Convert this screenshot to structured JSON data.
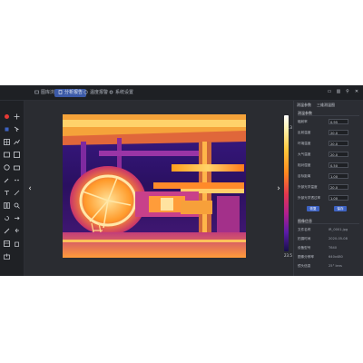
{
  "tabs": [
    {
      "label": "图库浏览",
      "active": false
    },
    {
      "label": "分析报告",
      "active": true
    },
    {
      "label": "温度报警",
      "active": false
    },
    {
      "label": "系统设置",
      "active": false
    }
  ],
  "window_controls": [
    "minimize",
    "settings",
    "restore",
    "close"
  ],
  "left_tools": [
    "record-icon",
    "crosshair-icon",
    "grid-icon",
    "chart-icon",
    "image-icon",
    "line-icon",
    "palette-icon",
    "camera-icon",
    "text-icon",
    "pen-icon",
    "compare-icon",
    "zoom-icon",
    "rotate-icon",
    "brush-icon",
    "table-icon",
    "export-icon"
  ],
  "scale": {
    "top": "82.3",
    "bottom": "23.5"
  },
  "colors": {
    "accent": "#3c5aa8",
    "button": "#3d62c2"
  },
  "panel": {
    "tabs": [
      "测温参数",
      "三维测温图"
    ],
    "section1_title": "测温参数",
    "rows": [
      {
        "label": "辐射率",
        "value": "0.95",
        "type": "field"
      },
      {
        "label": "反射温度",
        "value": "20.0",
        "type": "field"
      },
      {
        "label": "环境温度",
        "value": "20.0",
        "type": "field"
      },
      {
        "label": "大气温度",
        "value": "20.0",
        "type": "field"
      },
      {
        "label": "相对湿度",
        "value": "0.50",
        "type": "field"
      },
      {
        "label": "目标距离",
        "value": "1.00",
        "type": "field"
      },
      {
        "label": "外部光学温度",
        "value": "20.0",
        "type": "field"
      },
      {
        "label": "外部光学透过率",
        "value": "1.00",
        "type": "field"
      }
    ],
    "buttons": [
      "恢复",
      "保存"
    ],
    "section2_title": "图像信息",
    "info": [
      {
        "label": "文件名称",
        "value": "IR_0001.jpg"
      },
      {
        "label": "拍摄时间",
        "value": "2020-05-08"
      },
      {
        "label": "设备型号",
        "value": "T640"
      },
      {
        "label": "图像分辨率",
        "value": "640x480"
      },
      {
        "label": "镜头信息",
        "value": "25° lens"
      }
    ]
  }
}
